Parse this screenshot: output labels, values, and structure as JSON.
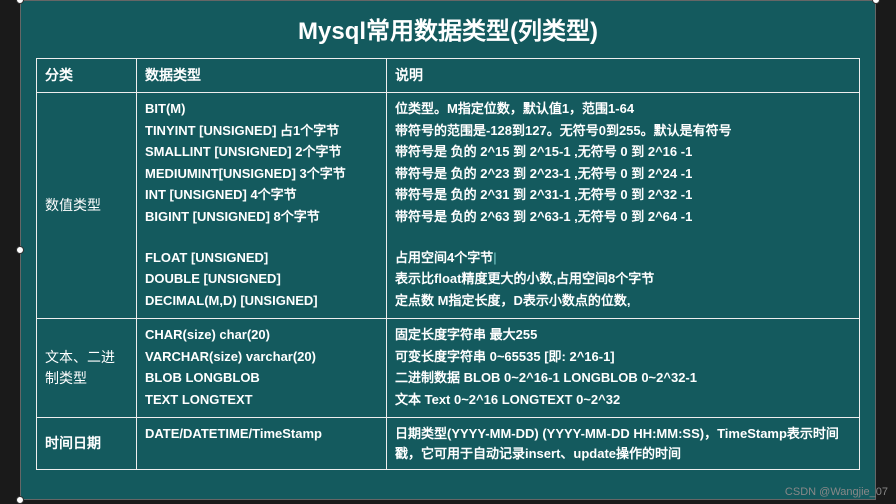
{
  "title": "Mysql常用数据类型(列类型)",
  "headers": {
    "cat": "分类",
    "type": "数据类型",
    "desc": "说明"
  },
  "cursor": "|",
  "rows": {
    "numeric": {
      "cat": "数值类型",
      "types": [
        "BIT(M)",
        "TINYINT [UNSIGNED]  占1个字节",
        "SMALLINT [UNSIGNED]  2个字节",
        "MEDIUMINT[UNSIGNED] 3个字节",
        "INT [UNSIGNED]  4个字节",
        "BIGINT [UNSIGNED] 8个字节",
        "",
        "FLOAT [UNSIGNED]",
        "DOUBLE [UNSIGNED]",
        "DECIMAL(M,D) [UNSIGNED]"
      ],
      "desc": [
        "位类型。M指定位数，默认值1，范围1-64",
        "带符号的范围是-128到127。无符号0到255。默认是有符号",
        "带符号是  负的 2^15 到 2^15-1 ,无符号 0 到 2^16 -1",
        "带符号是  负的 2^23 到 2^23-1 ,无符号 0 到 2^24 -1",
        "带符号是  负的 2^31 到 2^31-1 ,无符号 0 到 2^32 -1",
        "带符号是  负的 2^63 到 2^63-1 ,无符号 0 到 2^64 -1",
        "",
        "占用空间4个字节",
        "表示比float精度更大的小数,占用空间8个字节",
        "定点数 M指定长度，D表示小数点的位数,"
      ]
    },
    "text": {
      "cat": "文本、二进制类型",
      "types": [
        "CHAR(size) char(20)",
        "VARCHAR(size)  varchar(20)",
        "BLOB   LONGBLOB",
        "TEXT   LONGTEXT"
      ],
      "desc": [
        "固定长度字符串 最大255",
        "可变长度字符串 0~65535 [即: 2^16-1]",
        "二进制数据 BLOB 0~2^16-1 LONGBLOB 0~2^32-1",
        "文本 Text 0~2^16 LONGTEXT 0~2^32"
      ]
    },
    "date": {
      "cat": "时间日期",
      "type": "DATE/DATETIME/TimeStamp",
      "desc": "日期类型(YYYY-MM-DD)  (YYYY-MM-DD HH:MM:SS)，TimeStamp表示时间戳，它可用于自动记录insert、update操作的时间"
    }
  },
  "watermark": "CSDN @Wangjie_07"
}
